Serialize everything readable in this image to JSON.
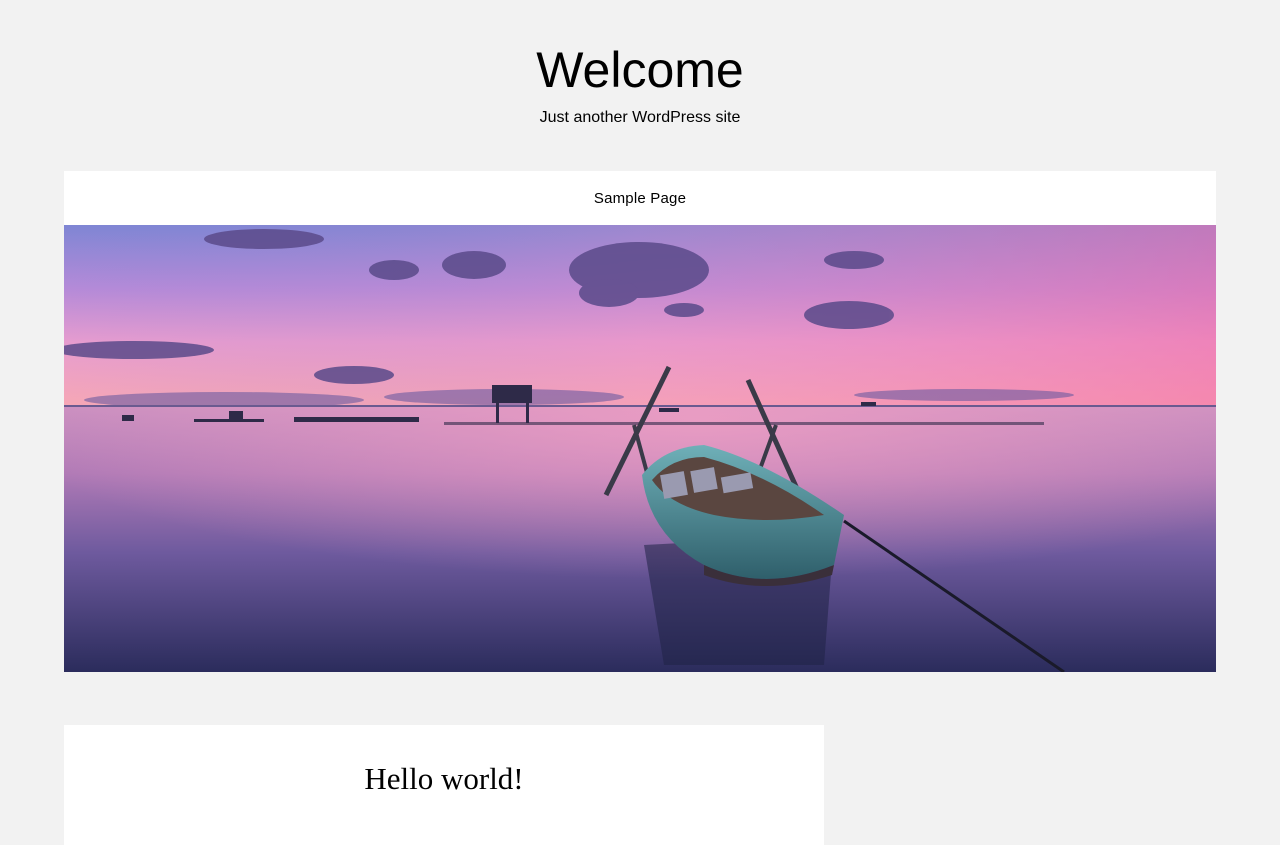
{
  "site": {
    "title": "Welcome",
    "tagline": "Just another WordPress site"
  },
  "nav": {
    "items": [
      {
        "label": "Sample Page"
      }
    ]
  },
  "hero": {
    "image": "sunset-lake-boat-photo",
    "colors": {
      "sky_top": "#8a8fd8",
      "sky_mid": "#e79ad0",
      "horizon": "#f4a3b8",
      "water_top": "#d48fb8",
      "water_bottom": "#2a2a5a",
      "boat": "#4f8d97"
    }
  },
  "post": {
    "title": "Hello world!"
  },
  "colors": {
    "page_background": "#f2f2f2",
    "panel_background": "#ffffff",
    "text": "#000000"
  }
}
